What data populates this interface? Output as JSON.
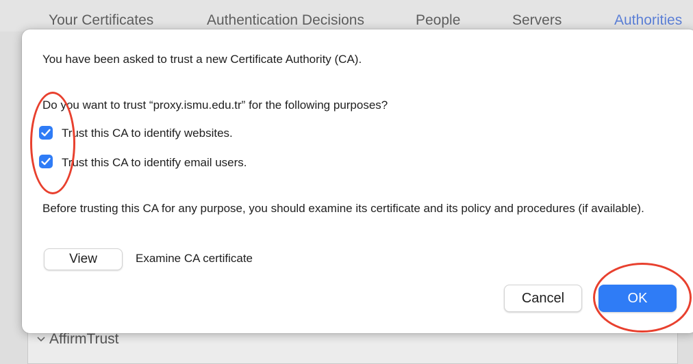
{
  "tabs": [
    "Your Certificates",
    "Authentication Decisions",
    "People",
    "Servers",
    "Authorities"
  ],
  "active_tab": "Authorities",
  "list": {
    "row_label": "AffirmTrust"
  },
  "dialog": {
    "intro": "You have been asked to trust a new Certificate Authority (CA).",
    "question": "Do you want to trust “proxy.ismu.edu.tr” for the following purposes?",
    "options": [
      {
        "label": "Trust this CA to identify websites.",
        "checked": true
      },
      {
        "label": "Trust this CA to identify email users.",
        "checked": true
      }
    ],
    "advice": "Before trusting this CA for any purpose, you should examine its certificate and its policy and procedures (if available).",
    "view_button": "View",
    "view_caption": "Examine CA certificate",
    "cancel_button": "Cancel",
    "ok_button": "OK"
  },
  "colors": {
    "accent": "#2f7cf6",
    "annotation": "#e8402e",
    "active_tab": "#5b7fd6"
  },
  "icons": {
    "checkbox": "checkmark-icon",
    "list_row": "chevron-down-icon"
  }
}
